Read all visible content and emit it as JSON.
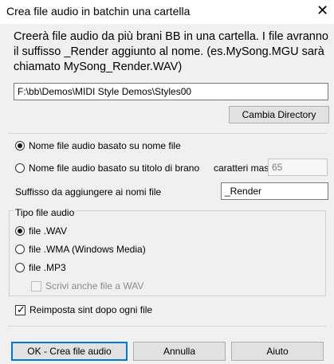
{
  "window": {
    "title": "Crea file audio in batchin una cartella",
    "close_glyph": "✕"
  },
  "description": "Creerà file audio da più brani BB in una cartella. I file avranno il suffisso _Render aggiunto al nome. (es.MySong.MGU sarà chiamato MySong_Render.WAV)",
  "directory": {
    "value": "F:\\bb\\Demos\\MIDI Style Demos\\Styles00",
    "button_label": "Cambia Directory"
  },
  "naming": {
    "option_filename_label": "Nome file audio basato su nome file",
    "option_filename_selected": true,
    "option_title_label": "Nome file audio basato su titolo di brano",
    "max_chars_label": "caratteri massimi=",
    "max_chars_value": "65",
    "suffix_label": "Suffisso da aggiungere ai nomi file",
    "suffix_value": "_Render"
  },
  "audio_type": {
    "group_label": "Tipo file audio",
    "options": [
      {
        "label": "file .WAV",
        "selected": true
      },
      {
        "label": "file .WMA (Windows Media)",
        "selected": false
      },
      {
        "label": "file .MP3",
        "selected": false
      }
    ],
    "also_wav_label": "Scrivi anche file a WAV",
    "also_wav_checked": false
  },
  "reset_synth": {
    "label": "Reimposta sint dopo ogni file",
    "checked": true
  },
  "buttons": {
    "ok_label": "OK - Crea file audio",
    "cancel_label": "Annulla",
    "help_label": "Aiuto"
  }
}
